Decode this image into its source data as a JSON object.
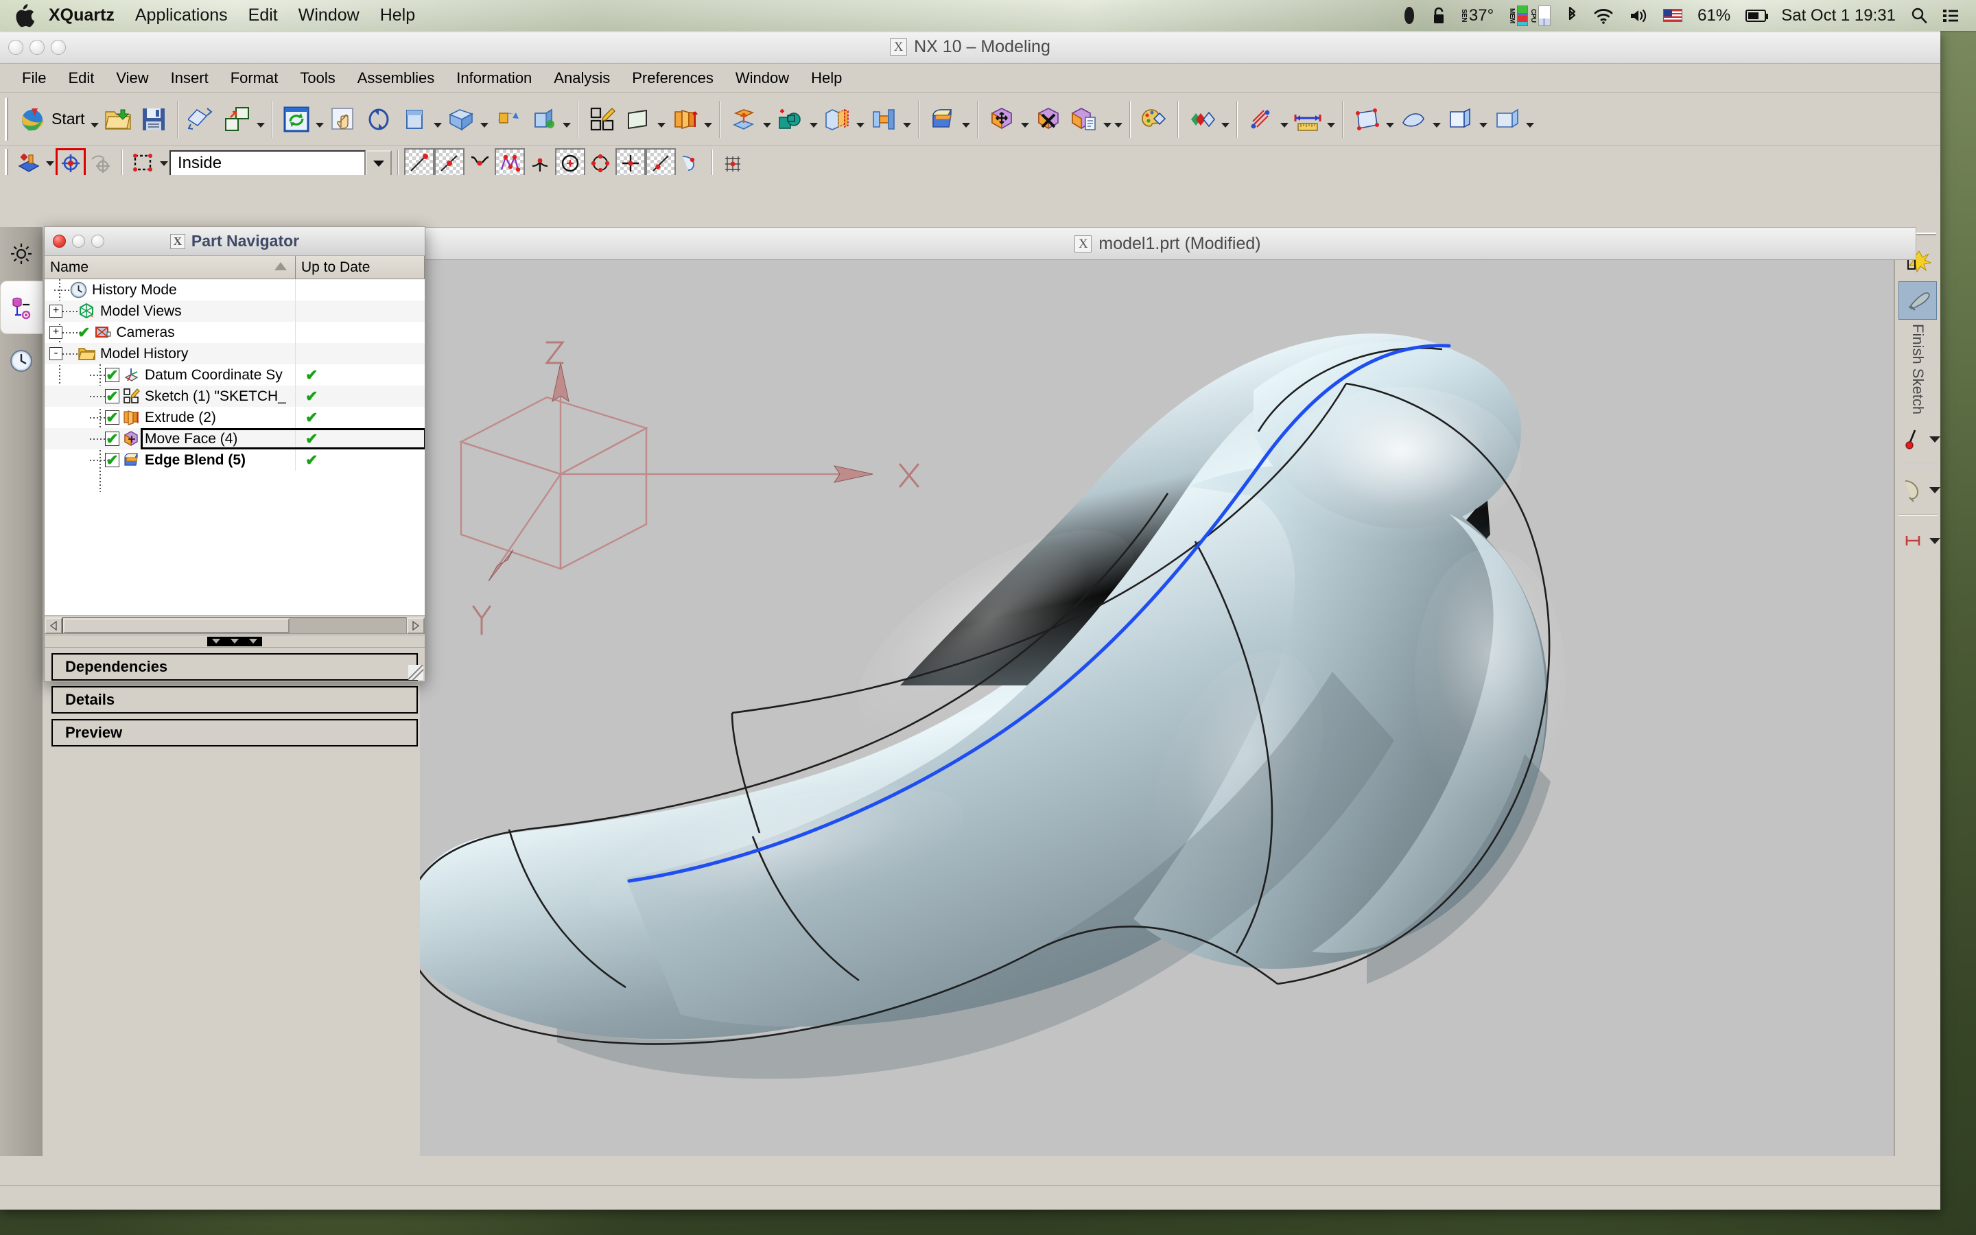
{
  "macbar": {
    "apple_icon": "apple-logo",
    "items": [
      {
        "label": "XQuartz",
        "bold": true
      },
      {
        "label": "Applications",
        "bold": false
      },
      {
        "label": "Edit",
        "bold": false
      },
      {
        "label": "Window",
        "bold": false
      },
      {
        "label": "Help",
        "bold": false
      }
    ],
    "status": {
      "dropbox_icon": "dropbox-icon",
      "lock_icon": "lock-icon",
      "sensor_label": "SEN",
      "temperature": "37°",
      "mem_label": "MEM",
      "cpu_label": "CPU",
      "bluetooth_icon": "bluetooth-icon",
      "wifi_icon": "wifi-icon",
      "volume_icon": "volume-icon",
      "flag_icon": "us-flag-icon",
      "battery_percent": "61%",
      "battery_icon": "battery-icon",
      "clock": "Sat Oct 1  19:31",
      "search_icon": "search-icon",
      "notification_icon": "notification-center-icon"
    }
  },
  "nx_window": {
    "title": "NX 10 – Modeling",
    "title_icon": "x-window-icon",
    "menu": [
      {
        "label": "File",
        "mnemonic": "F"
      },
      {
        "label": "Edit",
        "mnemonic": "E"
      },
      {
        "label": "View",
        "mnemonic": "V"
      },
      {
        "label": "Insert",
        "mnemonic": "I"
      },
      {
        "label": "Format",
        "mnemonic": "o"
      },
      {
        "label": "Tools",
        "mnemonic": "T"
      },
      {
        "label": "Assemblies",
        "mnemonic": "A"
      },
      {
        "label": "Information",
        "mnemonic": "N"
      },
      {
        "label": "Analysis",
        "mnemonic": "L"
      },
      {
        "label": "Preferences",
        "mnemonic": "P"
      },
      {
        "label": "Window",
        "mnemonic": "W"
      },
      {
        "label": "Help",
        "mnemonic": "H"
      }
    ],
    "toolbar_standard": {
      "start_label": "Start",
      "buttons": [
        {
          "name": "start-menu-icon",
          "label": "Start"
        },
        {
          "name": "open-file-icon",
          "label": "Open"
        },
        {
          "name": "save-icon",
          "label": "Save"
        },
        {
          "name": "print-icon",
          "label": "Print"
        },
        {
          "name": "copy-paste-icon",
          "label": "Paste Special"
        },
        {
          "name": "refresh-icon",
          "label": "Refresh"
        },
        {
          "name": "fit-view-icon",
          "label": "Fit View"
        },
        {
          "name": "rotate-icon",
          "label": "Rotate"
        },
        {
          "name": "zoom-icon",
          "label": "Zoom"
        },
        {
          "name": "pan-icon",
          "label": "Pan"
        },
        {
          "name": "perspective-icon",
          "label": "Perspective"
        },
        {
          "name": "orient-view-icon",
          "label": "Orient View"
        },
        {
          "name": "render-style-icon",
          "label": "Render Style"
        },
        {
          "name": "sketch-icon",
          "label": "Sketch in Task Environment"
        },
        {
          "name": "datum-plane-icon",
          "label": "Datum Plane"
        },
        {
          "name": "extrude-icon",
          "label": "Extrude"
        },
        {
          "name": "revolve-icon",
          "label": "Revolve"
        },
        {
          "name": "unite-icon",
          "label": "Unite"
        },
        {
          "name": "shell-icon",
          "label": "Shell"
        },
        {
          "name": "draft-icon",
          "label": "Draft"
        },
        {
          "name": "edge-blend-icon",
          "label": "Edge Blend"
        },
        {
          "name": "move-face-icon",
          "label": "Move Face"
        },
        {
          "name": "delete-face-icon",
          "label": "Delete Face"
        },
        {
          "name": "offset-face-icon",
          "label": "Offset Region"
        },
        {
          "name": "color-palette-icon",
          "label": "Edit Object Display"
        },
        {
          "name": "section-icon",
          "label": "View Section"
        },
        {
          "name": "measure-distance-icon",
          "label": "Measure Distance"
        },
        {
          "name": "rule-icon",
          "label": "Measure"
        },
        {
          "name": "geometry-patch-icon",
          "label": "Patch"
        },
        {
          "name": "surface-icon",
          "label": "Surface"
        },
        {
          "name": "sheet-icon",
          "label": "Sheet Body"
        },
        {
          "name": "more-icon",
          "label": "More"
        }
      ]
    },
    "toolbar_sketch": {
      "selection_scope_value": "Inside",
      "buttons": [
        {
          "name": "snap-point-icon",
          "label": "Snap Point"
        },
        {
          "name": "point-on-curve-icon",
          "label": "Enable Snap Point"
        },
        {
          "name": "no-snap-icon",
          "label": "Disable Snap"
        },
        {
          "name": "selection-rect-icon",
          "label": "Rectangle Selection"
        },
        {
          "name": "profile-line-icon",
          "label": "Profile"
        },
        {
          "name": "line-icon",
          "label": "Line"
        },
        {
          "name": "arc-icon",
          "label": "Arc"
        },
        {
          "name": "studio-spline-icon",
          "label": "Studio Spline"
        },
        {
          "name": "fillet-icon",
          "label": "Fillet"
        },
        {
          "name": "circle-icon",
          "label": "Circle"
        },
        {
          "name": "ellipse-icon",
          "label": "Ellipse"
        },
        {
          "name": "point-icon",
          "label": "Point"
        },
        {
          "name": "derived-line-icon",
          "label": "Derived Lines"
        },
        {
          "name": "offset-curve-icon",
          "label": "Offset Curve"
        },
        {
          "name": "pattern-curve-icon",
          "label": "Pattern Curve"
        }
      ]
    }
  },
  "resource_bar": {
    "tabs": [
      {
        "name": "assembly-navigator-icon",
        "label": "Assembly Navigator",
        "active": false
      },
      {
        "name": "part-navigator-icon",
        "label": "Part Navigator",
        "active": true
      },
      {
        "name": "history-icon",
        "label": "History",
        "active": false
      }
    ]
  },
  "part_navigator": {
    "title": "Part Navigator",
    "title_icon": "x-window-icon",
    "window_buttons": [
      "close-button",
      "minimize-button",
      "zoom-button"
    ],
    "columns": [
      {
        "label": "Name",
        "sorted": true
      },
      {
        "label": "Up to Date",
        "sorted": false
      }
    ],
    "tree": [
      {
        "label": "History Mode",
        "icon": "clock-icon",
        "depth": 1,
        "expander": "",
        "check": null,
        "uptodate": "",
        "bold": false,
        "selected": false
      },
      {
        "label": "Model Views",
        "icon": "model-views-icon",
        "depth": 1,
        "expander": "+",
        "check": null,
        "uptodate": "",
        "bold": false,
        "selected": false
      },
      {
        "label": "Cameras",
        "icon": "camera-icon",
        "depth": 1,
        "expander": "+",
        "check": "mark",
        "uptodate": "",
        "bold": false,
        "selected": false
      },
      {
        "label": "Model History",
        "icon": "folder-icon",
        "depth": 1,
        "expander": "-",
        "check": null,
        "uptodate": "",
        "bold": false,
        "selected": false
      },
      {
        "label": "Datum Coordinate Sy",
        "icon": "datum-csys-icon",
        "depth": 2,
        "expander": "",
        "check": true,
        "uptodate": "✔",
        "bold": false,
        "selected": false
      },
      {
        "label": "Sketch (1) \"SKETCH_",
        "icon": "sketch-feature-icon",
        "depth": 2,
        "expander": "",
        "check": true,
        "uptodate": "✔",
        "bold": false,
        "selected": false
      },
      {
        "label": "Extrude (2)",
        "icon": "extrude-feature-icon",
        "depth": 2,
        "expander": "",
        "check": true,
        "uptodate": "✔",
        "bold": false,
        "selected": false
      },
      {
        "label": "Move Face (4)",
        "icon": "move-face-feature-icon",
        "depth": 2,
        "expander": "",
        "check": true,
        "uptodate": "✔",
        "bold": false,
        "selected": true
      },
      {
        "label": "Edge Blend (5)",
        "icon": "edge-blend-feature-icon",
        "depth": 2,
        "expander": "",
        "check": true,
        "uptodate": "✔",
        "bold": true,
        "selected": false
      }
    ],
    "panels": [
      {
        "label": "Dependencies"
      },
      {
        "label": "Details"
      },
      {
        "label": "Preview"
      }
    ]
  },
  "graphics_window": {
    "title": "model1.prt (Modified)",
    "title_icon": "x-window-icon",
    "background_color": "#c3c3c3",
    "csys": {
      "x_label": "X",
      "y_label": "Y",
      "z_label": "Z",
      "color": "#c08080"
    },
    "model": {
      "body_color": "#b9c9ce",
      "highlight_color": "#e4f1f5",
      "shadow_color": "#6f7d82",
      "selected_edge_color": "#1a4cf0",
      "edge_color": "#202020"
    }
  },
  "right_toolbar": {
    "finish_sketch_label": "Finish Sketch",
    "buttons": [
      {
        "name": "sketch-constraint-icon",
        "label": "Geometric Constraints"
      },
      {
        "name": "finish-sketch-icon",
        "label": "Finish Sketch"
      },
      {
        "name": "make-symmetric-icon",
        "label": "Make Symmetric"
      },
      {
        "name": "animate-dimension-icon",
        "label": "Animate Dimension"
      },
      {
        "name": "rapid-dimension-icon",
        "label": "Rapid Dimension"
      }
    ]
  }
}
